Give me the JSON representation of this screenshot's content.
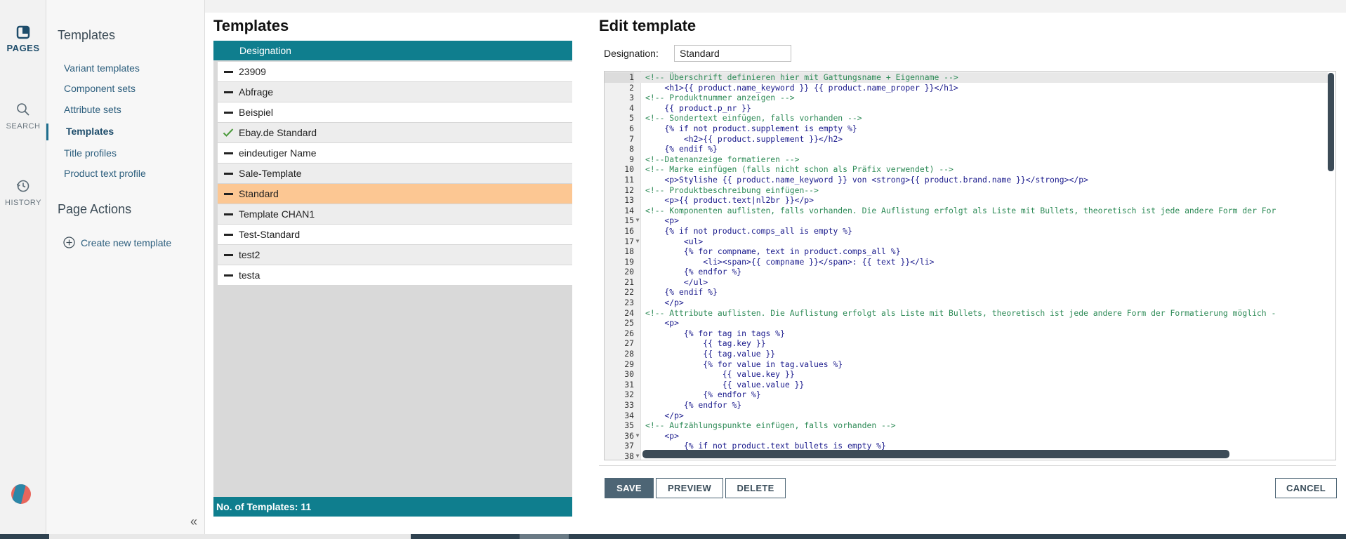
{
  "rail": {
    "pages_label": "PAGES",
    "search_label": "SEARCH",
    "history_label": "HISTORY"
  },
  "nav": {
    "section1_title": "Templates",
    "items": [
      {
        "label": "Variant templates"
      },
      {
        "label": "Component sets"
      },
      {
        "label": "Attribute sets"
      },
      {
        "label": "Templates"
      },
      {
        "label": "Title profiles"
      },
      {
        "label": "Product text profile"
      }
    ],
    "section2_title": "Page Actions",
    "create_label": "Create new template",
    "collapse_icon": "«"
  },
  "templates": {
    "title": "Templates",
    "column_header": "Designation",
    "rows": [
      {
        "name": "23909",
        "marker": "dash"
      },
      {
        "name": "Abfrage",
        "marker": "dash"
      },
      {
        "name": "Beispiel",
        "marker": "dash"
      },
      {
        "name": "Ebay.de Standard",
        "marker": "check"
      },
      {
        "name": "eindeutiger Name",
        "marker": "dash"
      },
      {
        "name": "Sale-Template",
        "marker": "dash"
      },
      {
        "name": "Standard",
        "marker": "dash",
        "selected": true
      },
      {
        "name": "Template CHAN1",
        "marker": "dash"
      },
      {
        "name": "Test-Standard",
        "marker": "dash"
      },
      {
        "name": "test2",
        "marker": "dash"
      },
      {
        "name": "testa",
        "marker": "dash"
      }
    ],
    "footer": "No. of Templates: 11"
  },
  "edit": {
    "title": "Edit template",
    "designation_label": "Designation:",
    "designation_value": "Standard",
    "code_lines": [
      "<!-- Überschrift definieren hier mit Gattungsname + Eigenname -->",
      "    <h1>{{ product.name_keyword }} {{ product.name_proper }}</h1>",
      "<!-- Produktnummer anzeigen -->",
      "    {{ product.p_nr }}",
      "<!-- Sondertext einfügen, falls vorhanden -->",
      "    {% if not product.supplement is empty %}",
      "        <h2>{{ product.supplement }}</h2>",
      "    {% endif %}",
      "<!--Datenanzeige formatieren -->",
      "<!-- Marke einfügen (falls nicht schon als Präfix verwendet) -->",
      "    <p>Stylishe {{ product.name_keyword }} von <strong>{{ product.brand.name }}</strong></p>",
      "<!-- Produktbeschreibung einfügen-->",
      "    <p>{{ product.text|nl2br }}</p>",
      "<!-- Komponenten auflisten, falls vorhanden. Die Auflistung erfolgt als Liste mit Bullets, theoretisch ist jede andere Form der For",
      "    <p>",
      "    {% if not product.comps_all is empty %}",
      "        <ul>",
      "        {% for compname, text in product.comps_all %}",
      "            <li><span>{{ compname }}</span>: {{ text }}</li>",
      "        {% endfor %}",
      "        </ul>",
      "    {% endif %}",
      "    </p>",
      "<!-- Attribute auflisten. Die Auflistung erfolgt als Liste mit Bullets, theoretisch ist jede andere Form der Formatierung möglich -",
      "    <p>",
      "        {% for tag in tags %}",
      "            {{ tag.key }}",
      "            {{ tag.value }}",
      "            {% for value in tag.values %}",
      "                {{ value.key }}",
      "                {{ value.value }}",
      "            {% endfor %}",
      "        {% endfor %}",
      "    </p>",
      "<!-- Aufzählungspunkte einfügen, falls vorhanden -->",
      "    <p>",
      "        {% if not product.text_bullets is empty %}",
      ""
    ],
    "fold_lines": [
      15,
      17,
      36,
      38
    ],
    "buttons": {
      "save": "SAVE",
      "preview": "PREVIEW",
      "delete": "DELETE",
      "cancel": "CANCEL"
    }
  },
  "colors": {
    "teal": "#0f7e8e",
    "selected_row": "#fcc793",
    "button_dark": "#4d6575"
  }
}
